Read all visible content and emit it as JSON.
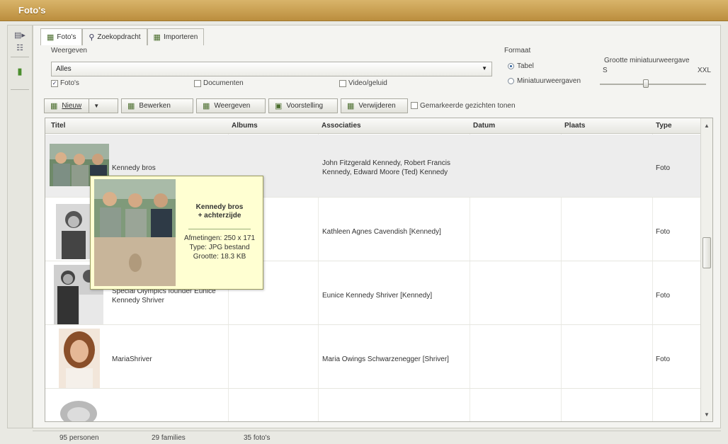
{
  "window": {
    "title": "Foto's"
  },
  "tabs": [
    {
      "label": "Foto's",
      "icon": "photos-icon"
    },
    {
      "label": "Zoekopdracht",
      "icon": "search-icon"
    },
    {
      "label": "Importeren",
      "icon": "import-icon"
    }
  ],
  "view": {
    "label": "Weergeven",
    "selected": "Alles",
    "checkboxes": [
      {
        "label": "Foto's",
        "checked": true
      },
      {
        "label": "Documenten",
        "checked": false
      },
      {
        "label": "Video/geluid",
        "checked": false
      }
    ]
  },
  "format": {
    "label": "Formaat",
    "options": [
      {
        "label": "Tabel",
        "selected": true
      },
      {
        "label": "Miniatuurweergaven",
        "selected": false
      }
    ],
    "thumb_size_label": "Grootte miniatuurweergave",
    "size_min": "S",
    "size_max": "XXL",
    "size_level": 0.35
  },
  "toolbar": {
    "new": "Nieuw",
    "edit": "Bewerken",
    "view": "Weergeven",
    "slideshow": "Voorstelling",
    "delete": "Verwijderen",
    "show_faces_label": "Gemarkeerde gezichten tonen"
  },
  "table": {
    "headers": {
      "title": "Titel",
      "albums": "Albums",
      "associations": "Associaties",
      "date": "Datum",
      "place": "Plaats",
      "type": "Type"
    },
    "rows": [
      {
        "title": "Kennedy bros",
        "albums": "",
        "associations": "John Fitzgerald Kennedy, Robert Francis Kennedy, Edward Moore (Ted) Kennedy",
        "date": "",
        "place": "",
        "type": "Foto"
      },
      {
        "title": "",
        "albums": "",
        "associations": "Kathleen Agnes Cavendish [Kennedy]",
        "date": "",
        "place": "",
        "type": "Foto"
      },
      {
        "title": "Special Olympics founder Eunice Kennedy Shriver",
        "albums": "",
        "associations": "Eunice Kennedy Shriver [Kennedy]",
        "date": "",
        "place": "",
        "type": "Foto"
      },
      {
        "title": "MariaShriver",
        "albums": "",
        "associations": "Maria Owings Schwarzenegger [Shriver]",
        "date": "",
        "place": "",
        "type": "Foto"
      }
    ]
  },
  "tooltip": {
    "title_line1": "Kennedy bros",
    "title_line2": "+ achterzijde",
    "dimensions": "Afmetingen: 250 x 171",
    "type": "Type: JPG bestand",
    "size": "Grootte: 18.3 KB"
  },
  "status": {
    "persons": "95 personen",
    "families": "29 families",
    "photos": "35 foto's"
  }
}
